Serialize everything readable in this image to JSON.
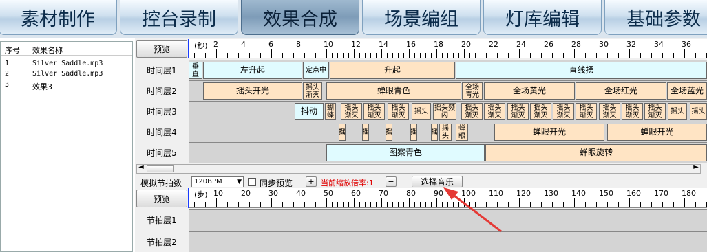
{
  "tabs": [
    {
      "label": "素材制作"
    },
    {
      "label": "控台录制"
    },
    {
      "label": "效果合成"
    },
    {
      "label": "场景编组"
    },
    {
      "label": "灯库编辑"
    },
    {
      "label": "基础参数"
    }
  ],
  "effect_list": {
    "col_index": "序号",
    "col_name": "效果名称",
    "rows": [
      {
        "index": "1",
        "name": "Silver Saddle.mp3"
      },
      {
        "index": "2",
        "name": "Silver Saddle.mp3"
      },
      {
        "index": "3",
        "name": "效果3"
      }
    ]
  },
  "timeline": {
    "preview_label": "预览",
    "ruler_unit": "(秒)",
    "ruler_labels": [
      "0",
      "2",
      "4",
      "6",
      "8",
      "10",
      "12",
      "14",
      "16",
      "18",
      "20",
      "22",
      "24",
      "26",
      "28",
      "30",
      "32",
      "34",
      "36"
    ],
    "layers": [
      {
        "label": "时间层1",
        "blocks": [
          {
            "text": "垂直",
            "c": "c"
          },
          {
            "text": "左升起",
            "c": "c"
          },
          {
            "text": "定点中",
            "c": "c"
          },
          {
            "text": "升起",
            "c": "o"
          },
          {
            "text": "直线摆",
            "c": "c"
          }
        ]
      },
      {
        "label": "时间层2",
        "blocks": [
          {
            "text": "摇头开光",
            "c": "o"
          },
          {
            "text": "摇头渐灭",
            "c": "o"
          },
          {
            "text": "蝉眼青色",
            "c": "o"
          },
          {
            "text": "全场青光",
            "c": "o"
          },
          {
            "text": "全场黄光",
            "c": "o"
          },
          {
            "text": "全场红光",
            "c": "o"
          },
          {
            "text": "全场蓝光",
            "c": "o"
          }
        ]
      },
      {
        "label": "时间层3",
        "blocks": [
          {
            "text": "抖动",
            "c": "c"
          },
          {
            "text": "蝴蝶",
            "c": "o"
          },
          {
            "text": "摇头渐灭",
            "c": "o"
          },
          {
            "text": "摇头渐灭",
            "c": "o"
          },
          {
            "text": "摇头渐灭",
            "c": "o"
          },
          {
            "text": "摇头",
            "c": "o"
          },
          {
            "text": "摇头频闪",
            "c": "o"
          },
          {
            "text": "摇头渐灭",
            "c": "o"
          },
          {
            "text": "摇头渐灭",
            "c": "o"
          },
          {
            "text": "摇头渐灭",
            "c": "o"
          },
          {
            "text": "摇头渐灭",
            "c": "o"
          },
          {
            "text": "摇头渐灭",
            "c": "o"
          },
          {
            "text": "摇头渐灭",
            "c": "o"
          },
          {
            "text": "摇头渐灭",
            "c": "o"
          },
          {
            "text": "摇头渐灭",
            "c": "o"
          },
          {
            "text": "摇头渐灭",
            "c": "o"
          },
          {
            "text": "摇头",
            "c": "o"
          },
          {
            "text": "摇头",
            "c": "o"
          }
        ]
      },
      {
        "label": "时间层4",
        "blocks": [
          {
            "text": "摇",
            "c": "o"
          },
          {
            "text": "摇",
            "c": "o"
          },
          {
            "text": "摇",
            "c": "o"
          },
          {
            "text": "摇",
            "c": "o"
          },
          {
            "text": "摇",
            "c": "o"
          },
          {
            "text": "摇头",
            "c": "o"
          },
          {
            "text": "蝉眼",
            "c": "o"
          },
          {
            "text": "蝉眼开光",
            "c": "o"
          },
          {
            "text": "蝉眼开光",
            "c": "o"
          }
        ]
      },
      {
        "label": "时间层5",
        "blocks": [
          {
            "text": "图案青色",
            "c": "c"
          },
          {
            "text": "蝉眼旋转",
            "c": "o"
          }
        ]
      }
    ]
  },
  "controls": {
    "bpm_label": "模拟节拍数",
    "bpm_value": "120BPM",
    "sync_preview": "同步预览",
    "plus": "+",
    "zoom_label": "当前缩放倍率:1",
    "minus": "−",
    "select_music": "选择音乐"
  },
  "beat": {
    "preview_label": "预览",
    "ruler_unit": "(步)",
    "ruler_labels": [
      "0",
      "10",
      "20",
      "30",
      "40",
      "50",
      "60",
      "70",
      "80",
      "90",
      "100",
      "110",
      "120",
      "130",
      "140",
      "150",
      "160",
      "170",
      "180"
    ],
    "layers": [
      {
        "label": "节拍层1"
      },
      {
        "label": "节拍层2"
      }
    ]
  },
  "colors": {
    "cyan_block": "#e0fbff",
    "orange_block": "#ffe4c4",
    "zoom_text": "#e00000",
    "arrow": "#e53935"
  }
}
